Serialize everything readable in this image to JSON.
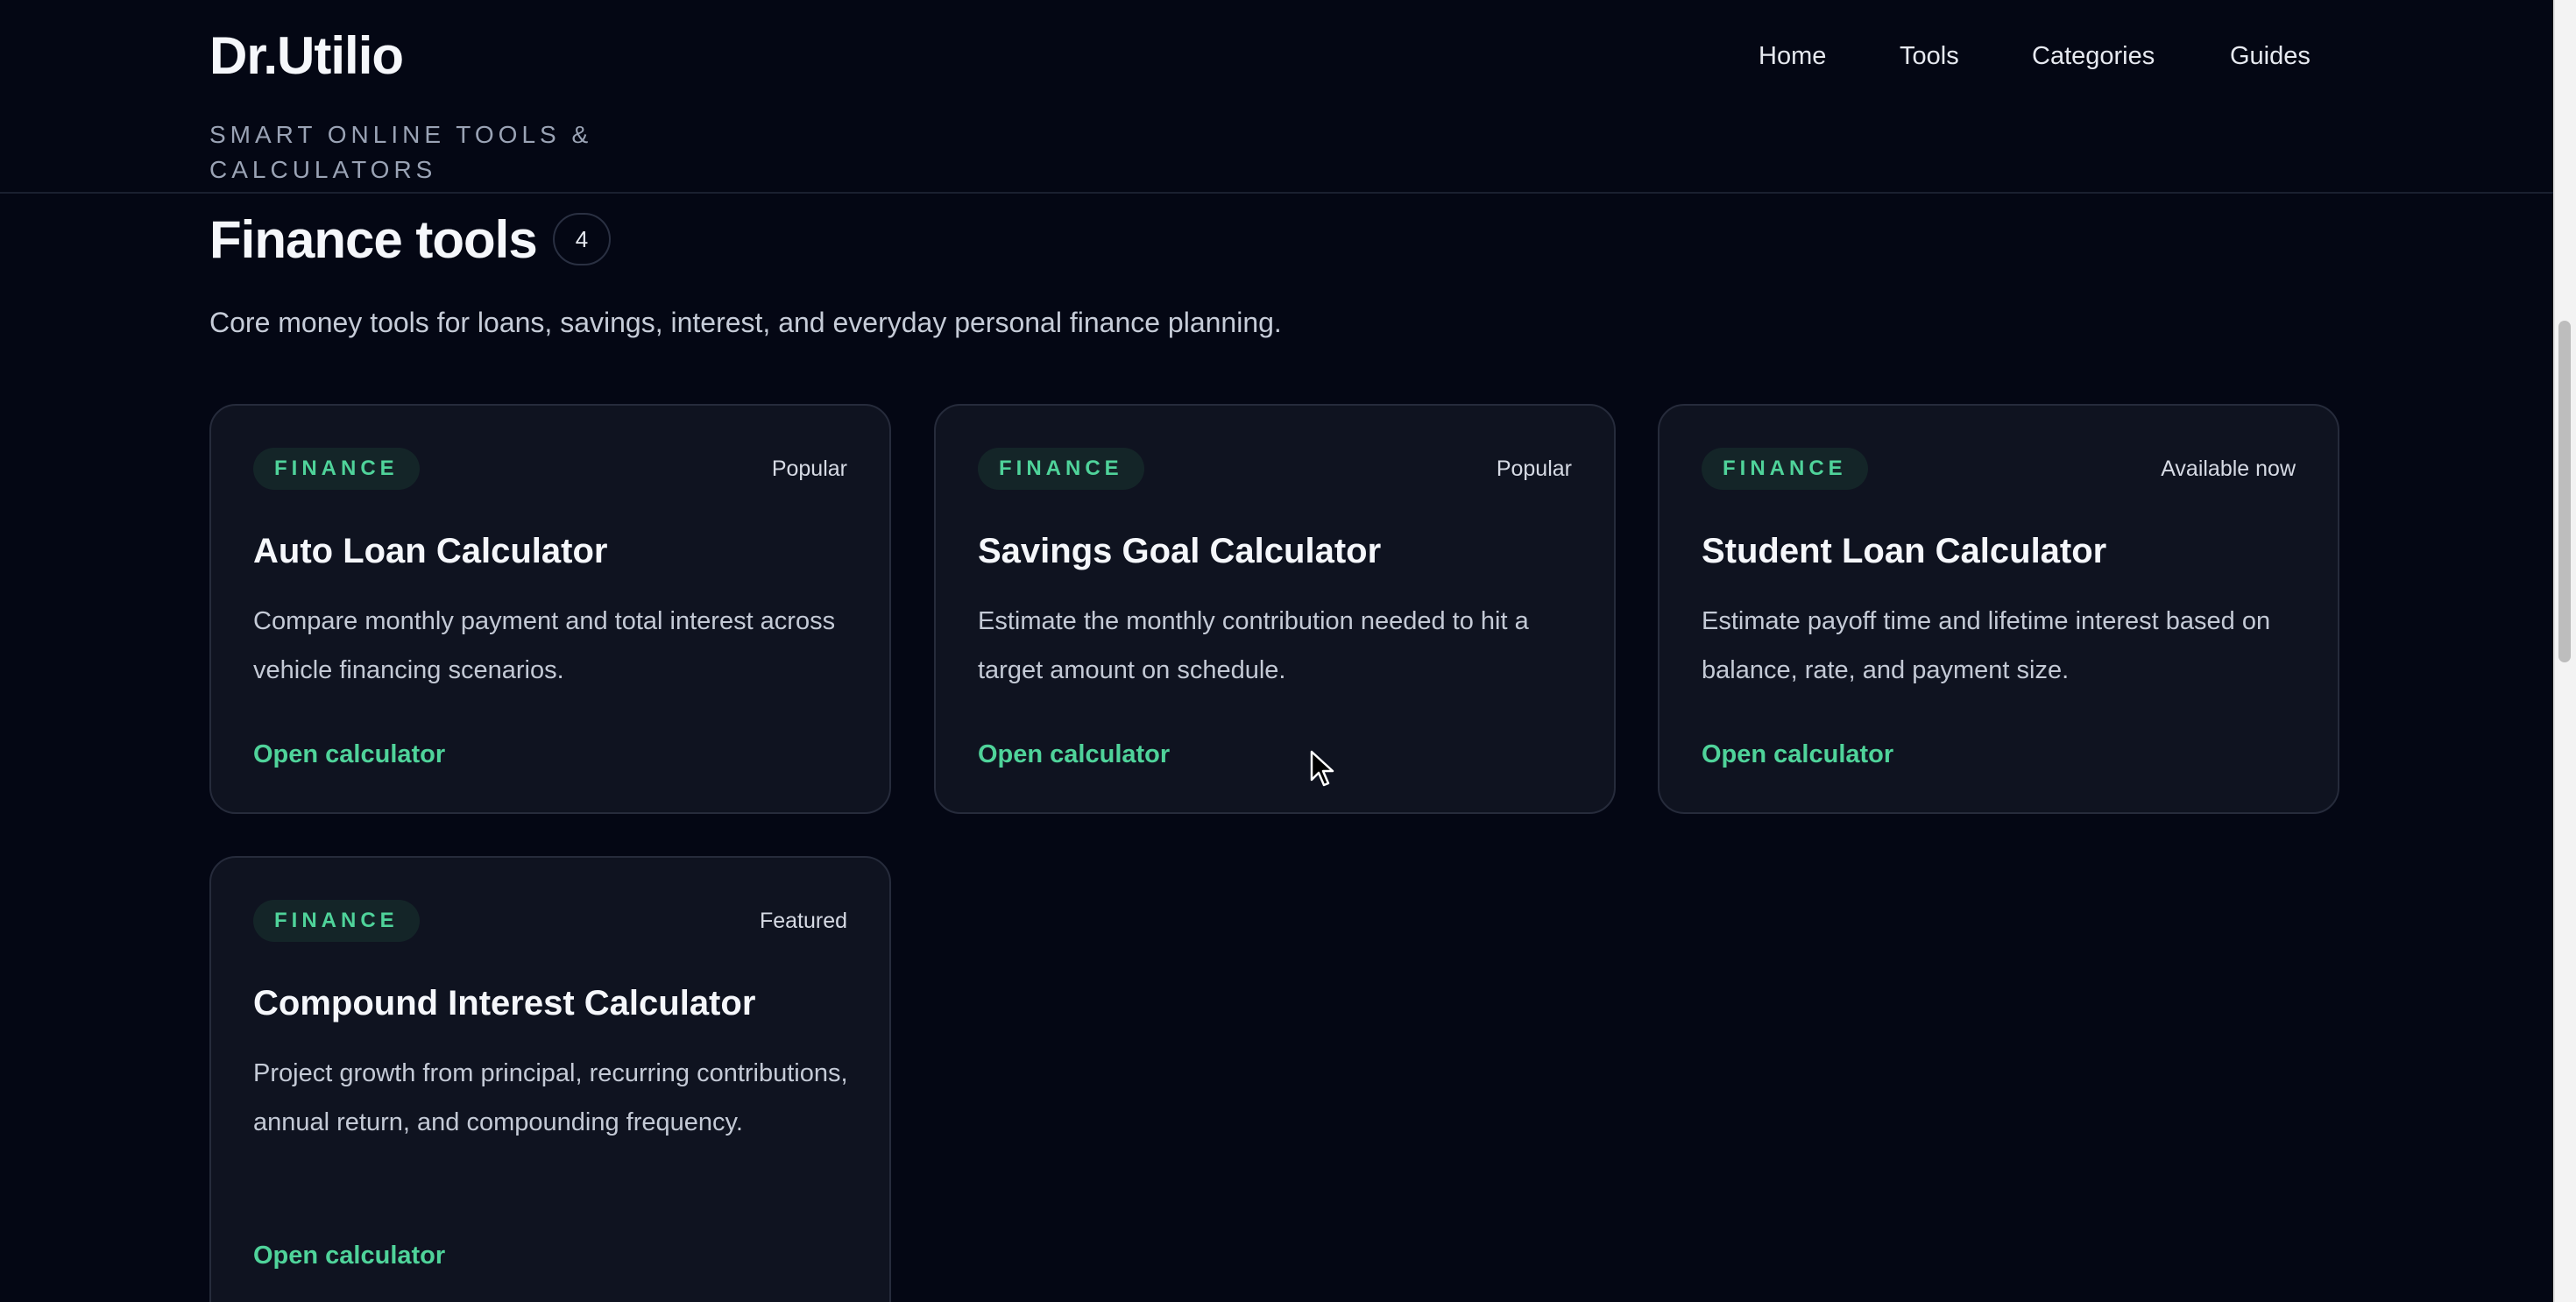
{
  "header": {
    "brand": "Dr.Utilio",
    "tagline": "SMART ONLINE TOOLS & CALCULATORS",
    "nav": [
      {
        "label": "Home"
      },
      {
        "label": "Tools"
      },
      {
        "label": "Categories"
      },
      {
        "label": "Guides"
      }
    ]
  },
  "section": {
    "title": "Finance tools",
    "count": "4",
    "description": "Core money tools for loans, savings, interest, and everyday personal finance planning."
  },
  "cards": [
    {
      "tag": "FINANCE",
      "status": "Popular",
      "title": "Auto Loan Calculator",
      "description": "Compare monthly payment and total interest across vehicle financing scenarios.",
      "cta": "Open calculator"
    },
    {
      "tag": "FINANCE",
      "status": "Popular",
      "title": "Savings Goal Calculator",
      "description": "Estimate the monthly contribution needed to hit a target amount on schedule.",
      "cta": "Open calculator"
    },
    {
      "tag": "FINANCE",
      "status": "Available now",
      "title": "Student Loan Calculator",
      "description": "Estimate payoff time and lifetime interest based on balance, rate, and payment size.",
      "cta": "Open calculator"
    },
    {
      "tag": "FINANCE",
      "status": "Featured",
      "title": "Compound Interest Calculator",
      "description": "Project growth from principal, recurring contributions, annual return, and compounding frequency.",
      "cta": "Open calculator"
    }
  ],
  "colors": {
    "background": "#040714",
    "card": "#0f1320",
    "accent": "#4fd39a"
  }
}
